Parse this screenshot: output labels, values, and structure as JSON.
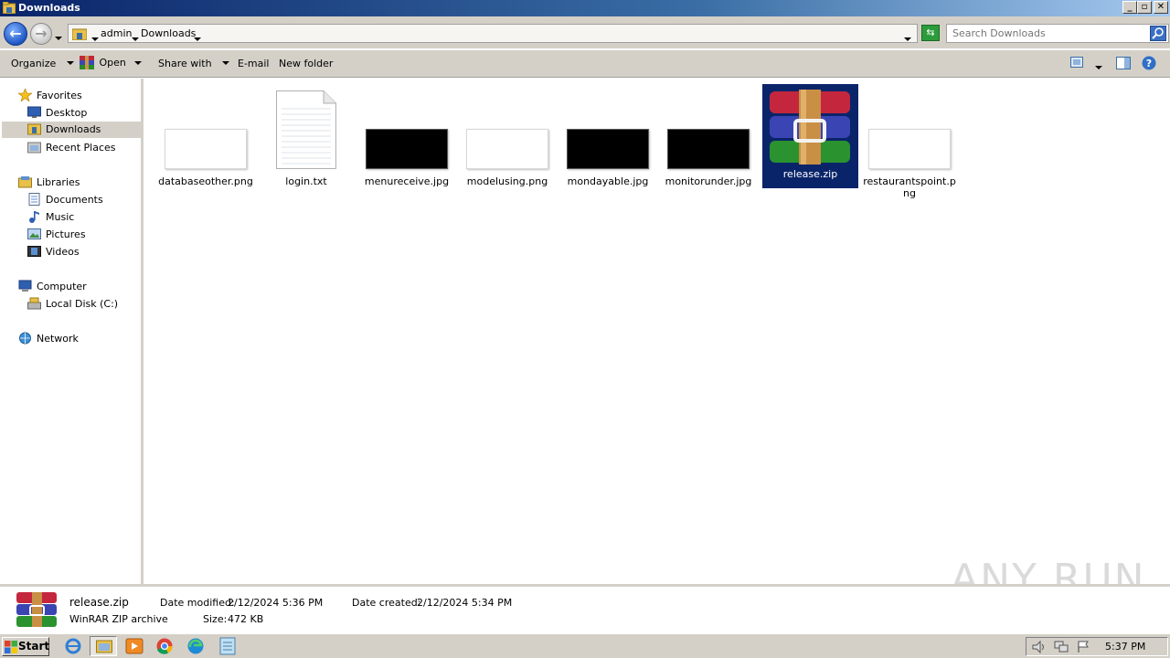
{
  "window": {
    "title": "Downloads"
  },
  "address": {
    "crumbs": [
      "admin",
      "Downloads"
    ],
    "search_placeholder": "Search Downloads"
  },
  "toolbar": {
    "organize": "Organize",
    "open": "Open",
    "share_with": "Share with",
    "email": "E-mail",
    "new_folder": "New folder"
  },
  "nav": {
    "favorites": "Favorites",
    "desktop": "Desktop",
    "downloads": "Downloads",
    "recent_places": "Recent Places",
    "libraries": "Libraries",
    "documents": "Documents",
    "music": "Music",
    "pictures": "Pictures",
    "videos": "Videos",
    "computer": "Computer",
    "local_disk": "Local Disk (C:)",
    "network": "Network"
  },
  "files": [
    {
      "name": "databaseother.png",
      "kind": "white-image"
    },
    {
      "name": "login.txt",
      "kind": "text-document"
    },
    {
      "name": "menureceive.jpg",
      "kind": "black-image"
    },
    {
      "name": "modelusing.png",
      "kind": "white-image"
    },
    {
      "name": "mondayable.jpg",
      "kind": "black-image"
    },
    {
      "name": "monitorunder.jpg",
      "kind": "black-image"
    },
    {
      "name": "release.zip",
      "kind": "winrar-archive",
      "selected": true
    },
    {
      "name": "restaurantspoint.png",
      "name_line1": "restaurantspoint.p",
      "name_line2": "ng",
      "kind": "white-image"
    }
  ],
  "details": {
    "name": "release.zip",
    "type": "WinRAR ZIP archive",
    "date_modified_label": "Date modified:",
    "date_modified": "2/12/2024 5:36 PM",
    "date_created_label": "Date created:",
    "date_created": "2/12/2024 5:34 PM",
    "size_label": "Size:",
    "size": "472 KB"
  },
  "taskbar": {
    "start": "Start",
    "clock": "5:37 PM",
    "apps": [
      "internet-explorer-icon",
      "explorer-icon",
      "media-player-icon",
      "chrome-icon",
      "edge-icon",
      "notepad-icon"
    ]
  },
  "watermark": "ANY RUN",
  "colors": {
    "selection": "#0a246a",
    "titlebar_start": "#0a246a",
    "chrome": "#d4d0c8"
  }
}
